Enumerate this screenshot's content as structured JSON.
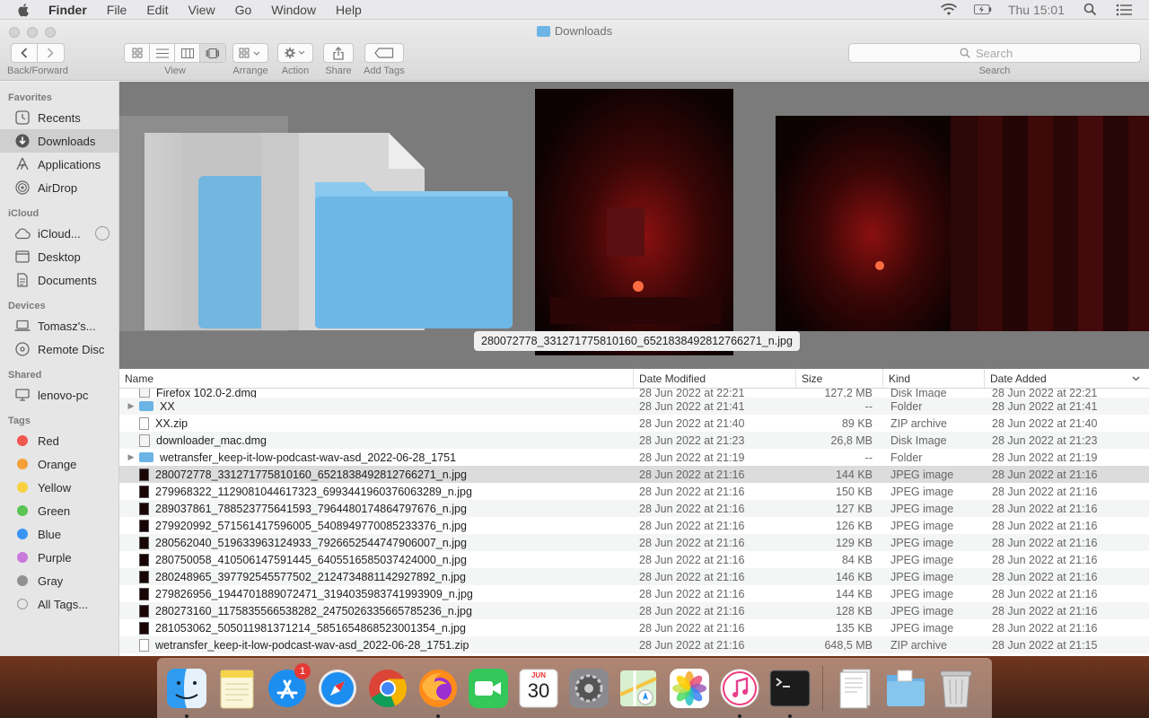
{
  "menubar": {
    "app": "Finder",
    "items": [
      "File",
      "Edit",
      "View",
      "Go",
      "Window",
      "Help"
    ],
    "clock": "Thu 15:01"
  },
  "window": {
    "title": "Downloads",
    "toolbar": {
      "back_forward_label": "Back/Forward",
      "view_label": "View",
      "arrange_label": "Arrange",
      "action_label": "Action",
      "share_label": "Share",
      "add_tags_label": "Add Tags",
      "search_label": "Search",
      "search_placeholder": "Search"
    }
  },
  "sidebar": {
    "favorites_header": "Favorites",
    "favorites": [
      {
        "label": "Recents",
        "icon": "clock-icon"
      },
      {
        "label": "Downloads",
        "icon": "download-icon",
        "selected": true
      },
      {
        "label": "Applications",
        "icon": "applications-icon"
      },
      {
        "label": "AirDrop",
        "icon": "airdrop-icon"
      }
    ],
    "icloud_header": "iCloud",
    "icloud": [
      {
        "label": "iCloud...",
        "icon": "cloud-icon"
      },
      {
        "label": "Desktop",
        "icon": "desktop-icon"
      },
      {
        "label": "Documents",
        "icon": "document-icon"
      }
    ],
    "devices_header": "Devices",
    "devices": [
      {
        "label": "Tomasz's...",
        "icon": "laptop-icon"
      },
      {
        "label": "Remote Disc",
        "icon": "disc-icon"
      }
    ],
    "shared_header": "Shared",
    "shared": [
      {
        "label": "lenovo-pc",
        "icon": "pc-icon"
      }
    ],
    "tags_header": "Tags",
    "tags": [
      {
        "label": "Red",
        "color": "#f0574f"
      },
      {
        "label": "Orange",
        "color": "#f5a036"
      },
      {
        "label": "Yellow",
        "color": "#f7d23e"
      },
      {
        "label": "Green",
        "color": "#5ac454"
      },
      {
        "label": "Blue",
        "color": "#3a94f6"
      },
      {
        "label": "Purple",
        "color": "#c879dc"
      },
      {
        "label": "Gray",
        "color": "#909090"
      },
      {
        "label": "All Tags...",
        "color": ""
      }
    ]
  },
  "preview": {
    "caption": "280072778_331271775810160_6521838492812766271_n.jpg"
  },
  "list": {
    "columns": {
      "name": "Name",
      "date_modified": "Date Modified",
      "size": "Size",
      "kind": "Kind",
      "date_added": "Date Added"
    },
    "rows": [
      {
        "name": "Firefox 102.0-2.dmg",
        "date": "28 Jun 2022 at 22:21",
        "size": "127,2 MB",
        "kind": "Disk Image",
        "added": "28 Jun 2022 at 22:21",
        "type": "dmg"
      },
      {
        "name": "XX",
        "date": "28 Jun 2022 at 21:41",
        "size": "--",
        "kind": "Folder",
        "added": "28 Jun 2022 at 21:41",
        "type": "folder"
      },
      {
        "name": "XX.zip",
        "date": "28 Jun 2022 at 21:40",
        "size": "89 KB",
        "kind": "ZIP archive",
        "added": "28 Jun 2022 at 21:40",
        "type": "doc"
      },
      {
        "name": "downloader_mac.dmg",
        "date": "28 Jun 2022 at 21:23",
        "size": "26,8 MB",
        "kind": "Disk Image",
        "added": "28 Jun 2022 at 21:23",
        "type": "dmg"
      },
      {
        "name": "wetransfer_keep-it-low-podcast-wav-asd_2022-06-28_1751",
        "date": "28 Jun 2022 at 21:19",
        "size": "--",
        "kind": "Folder",
        "added": "28 Jun 2022 at 21:19",
        "type": "folder"
      },
      {
        "name": "280072778_331271775810160_6521838492812766271_n.jpg",
        "date": "28 Jun 2022 at 21:16",
        "size": "144 KB",
        "kind": "JPEG image",
        "added": "28 Jun 2022 at 21:16",
        "type": "jpg",
        "selected": true
      },
      {
        "name": "279968322_1129081044617323_6993441960376063289_n.jpg",
        "date": "28 Jun 2022 at 21:16",
        "size": "150 KB",
        "kind": "JPEG image",
        "added": "28 Jun 2022 at 21:16",
        "type": "jpg"
      },
      {
        "name": "289037861_788523775641593_7964480174864797676_n.jpg",
        "date": "28 Jun 2022 at 21:16",
        "size": "127 KB",
        "kind": "JPEG image",
        "added": "28 Jun 2022 at 21:16",
        "type": "jpg"
      },
      {
        "name": "279920992_571561417596005_5408949770085233376_n.jpg",
        "date": "28 Jun 2022 at 21:16",
        "size": "126 KB",
        "kind": "JPEG image",
        "added": "28 Jun 2022 at 21:16",
        "type": "jpg"
      },
      {
        "name": "280562040_519633963124933_7926652544747906007_n.jpg",
        "date": "28 Jun 2022 at 21:16",
        "size": "129 KB",
        "kind": "JPEG image",
        "added": "28 Jun 2022 at 21:16",
        "type": "jpg"
      },
      {
        "name": "280750058_410506147591445_6405516585037424000_n.jpg",
        "date": "28 Jun 2022 at 21:16",
        "size": "84 KB",
        "kind": "JPEG image",
        "added": "28 Jun 2022 at 21:16",
        "type": "jpg"
      },
      {
        "name": "280248965_397792545577502_2124734881142927892_n.jpg",
        "date": "28 Jun 2022 at 21:16",
        "size": "146 KB",
        "kind": "JPEG image",
        "added": "28 Jun 2022 at 21:16",
        "type": "jpg"
      },
      {
        "name": "279826956_1944701889072471_3194035983741993909_n.jpg",
        "date": "28 Jun 2022 at 21:16",
        "size": "144 KB",
        "kind": "JPEG image",
        "added": "28 Jun 2022 at 21:16",
        "type": "jpg"
      },
      {
        "name": "280273160_1175835566538282_2475026335665785236_n.jpg",
        "date": "28 Jun 2022 at 21:16",
        "size": "128 KB",
        "kind": "JPEG image",
        "added": "28 Jun 2022 at 21:16",
        "type": "jpg"
      },
      {
        "name": "281053062_505011981371214_5851654868523001354_n.jpg",
        "date": "28 Jun 2022 at 21:16",
        "size": "135 KB",
        "kind": "JPEG image",
        "added": "28 Jun 2022 at 21:16",
        "type": "jpg"
      },
      {
        "name": "wetransfer_keep-it-low-podcast-wav-asd_2022-06-28_1751.zip",
        "date": "28 Jun 2022 at 21:16",
        "size": "648,5 MB",
        "kind": "ZIP archive",
        "added": "28 Jun 2022 at 21:15",
        "type": "doc"
      }
    ]
  },
  "dock": {
    "apps": [
      {
        "name": "finder",
        "running": true
      },
      {
        "name": "notes",
        "running": false
      },
      {
        "name": "app-store",
        "running": false,
        "badge": "1"
      },
      {
        "name": "safari",
        "running": false
      },
      {
        "name": "chrome",
        "running": false
      },
      {
        "name": "firefox",
        "running": true
      },
      {
        "name": "facetime",
        "running": false
      },
      {
        "name": "calendar",
        "running": false,
        "month": "JUN",
        "day": "30"
      },
      {
        "name": "system-preferences",
        "running": false
      },
      {
        "name": "maps",
        "running": false
      },
      {
        "name": "photos",
        "running": false
      },
      {
        "name": "itunes",
        "running": true
      },
      {
        "name": "terminal",
        "running": true
      }
    ],
    "stacks": [
      {
        "name": "documents-stack"
      },
      {
        "name": "downloads-stack"
      },
      {
        "name": "trash"
      }
    ]
  }
}
